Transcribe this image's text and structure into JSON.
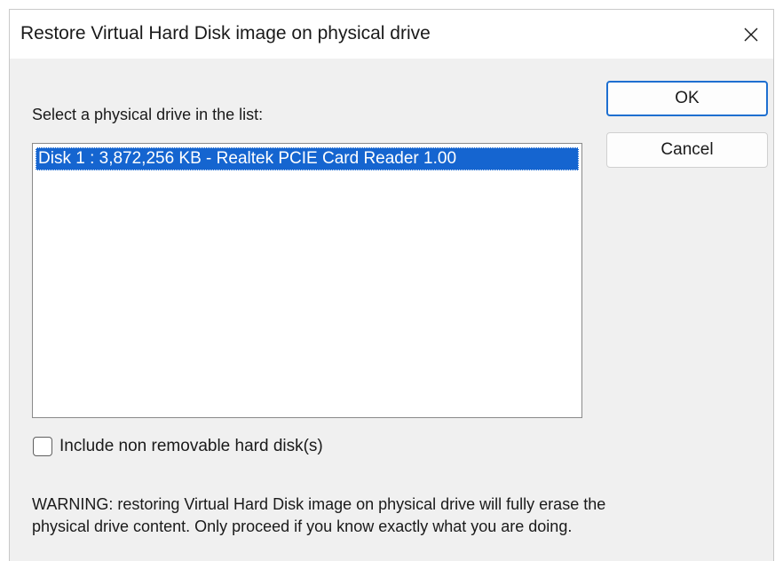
{
  "window": {
    "title": "Restore Virtual Hard Disk image on physical drive",
    "close_icon": "close-icon"
  },
  "main": {
    "prompt": "Select a physical drive in the list:",
    "drives": [
      {
        "label": "Disk 1 : 3,872,256 KB - Realtek PCIE Card Reader 1.00",
        "selected": true
      }
    ],
    "include_non_removable": {
      "label": "Include non removable hard disk(s)",
      "checked": false
    },
    "warning_line1": "WARNING: restoring Virtual Hard Disk image on physical drive will fully erase the",
    "warning_line2": "physical drive content. Only proceed if you know exactly what you are doing."
  },
  "buttons": {
    "ok": "OK",
    "cancel": "Cancel"
  },
  "colors": {
    "selection": "#1565d0",
    "default_button_border": "#1e6fd0",
    "dialog_background": "#f0f0f0"
  }
}
